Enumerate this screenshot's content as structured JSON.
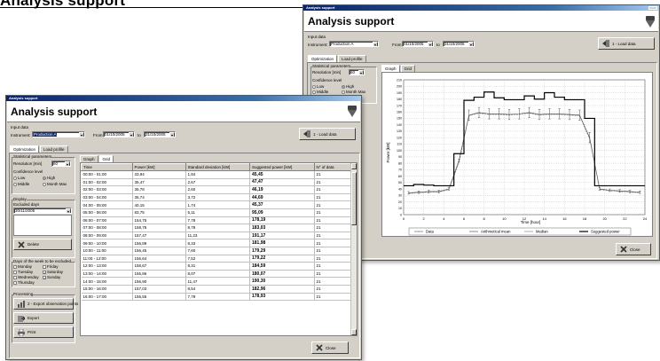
{
  "heading": "Analysis support",
  "app": {
    "window_caption": "Analysis support",
    "title": "Analysis support"
  },
  "input": {
    "section_label": "Input data",
    "instrument_label": "Instrument:",
    "instrument_value": "Production A",
    "from_label": "From",
    "from_value": "01/10/2005",
    "to_label": "to",
    "to_value": "31/10/2005",
    "load_button": "1 - Load data"
  },
  "tabs": [
    "Optimization",
    "Load profile"
  ],
  "sub_tabs": [
    "Graph",
    "Grid"
  ],
  "stats": {
    "group_label": "Statistical parameters",
    "resolution_label": "Resolution [min]",
    "resolution_value": "60",
    "confidence_label": "Confidence level",
    "options": [
      "Low",
      "High",
      "Middle",
      "Month Max"
    ],
    "selected": "High"
  },
  "display": {
    "label": "Display",
    "excluded_label": "Excluded days",
    "excluded_value": "30/11/2005",
    "delete_button": "Delete"
  },
  "days": {
    "label": "Days of the week to be excluded",
    "items": [
      {
        "name": "Monday",
        "checked": false
      },
      {
        "name": "Friday",
        "checked": false
      },
      {
        "name": "Tuesday",
        "checked": false
      },
      {
        "name": "Saturday",
        "checked": true
      },
      {
        "name": "Wednesday",
        "checked": false
      },
      {
        "name": "Sunday",
        "checked": true
      },
      {
        "name": "Thursday",
        "checked": false
      }
    ]
  },
  "processing": {
    "label": "Processing",
    "export_points": "2 - Export observation points",
    "export": "Export",
    "print": "Print"
  },
  "close_button": "Close",
  "grid": {
    "columns": [
      "Time",
      "Power [kW]",
      "Standard deviation [kW]",
      "Suggested power [kW]",
      "N° of data"
    ],
    "rows": [
      [
        "00:00 - 01:00",
        "33,94",
        "1,84",
        "45,45",
        "21"
      ],
      [
        "01:00 - 02:00",
        "35,47",
        "2,67",
        "47,47",
        "21"
      ],
      [
        "02:00 - 03:00",
        "35,78",
        "2,60",
        "46,19",
        "21"
      ],
      [
        "03:00 - 04:00",
        "35,74",
        "3,72",
        "44,69",
        "21"
      ],
      [
        "04:00 - 05:00",
        "40,15",
        "1,74",
        "45,37",
        "21"
      ],
      [
        "05:00 - 06:00",
        "83,75",
        "5,11",
        "95,09",
        "21"
      ],
      [
        "06:00 - 07:00",
        "154,75",
        "7,78",
        "178,19",
        "21"
      ],
      [
        "07:00 - 08:00",
        "158,75",
        "8,78",
        "183,03",
        "21"
      ],
      [
        "08:00 - 09:00",
        "157,47",
        "11,23",
        "191,17",
        "21"
      ],
      [
        "09:00 - 10:00",
        "156,89",
        "8,33",
        "181,98",
        "21"
      ],
      [
        "10:00 - 11:00",
        "156,45",
        "7,60",
        "179,29",
        "21"
      ],
      [
        "11:00 - 12:00",
        "156,64",
        "7,52",
        "179,22",
        "21"
      ],
      [
        "12:00 - 13:00",
        "158,67",
        "8,31",
        "184,59",
        "21"
      ],
      [
        "13:00 - 14:00",
        "155,86",
        "8,07",
        "180,07",
        "21"
      ],
      [
        "14:00 - 15:00",
        "156,90",
        "11,47",
        "190,30",
        "21"
      ],
      [
        "15:00 - 16:00",
        "157,03",
        "8,54",
        "182,96",
        "21"
      ],
      [
        "16:00 - 17:00",
        "155,55",
        "7,79",
        "178,93",
        "21"
      ]
    ]
  },
  "chart_data": {
    "type": "line",
    "ylabel": "Power [kW]",
    "xlabel": "Time [hour]",
    "xlim": [
      0,
      24
    ],
    "ylim": [
      0,
      210
    ],
    "x_ticks": [
      0,
      2,
      4,
      6,
      8,
      10,
      12,
      14,
      16,
      18,
      20,
      22,
      24
    ],
    "y_ticks": [
      0,
      10,
      20,
      30,
      40,
      50,
      60,
      70,
      80,
      90,
      100,
      110,
      120,
      130,
      140,
      150,
      160,
      170,
      180,
      190,
      200,
      210
    ],
    "grid": true,
    "legend_position": "bottom",
    "series": [
      {
        "name": "Data",
        "color": "#555555",
        "style": "error-bars",
        "x": [
          0.5,
          1.5,
          2.5,
          3.5,
          4.5,
          5.5,
          6.5,
          7.5,
          8.5,
          9.5,
          10.5,
          11.5,
          12.5,
          13.5,
          14.5,
          15.5,
          16.5,
          17.5,
          18.5,
          19.5,
          20.5,
          21.5,
          22.5,
          23.5
        ],
        "values": [
          34,
          35,
          36,
          36,
          40,
          84,
          155,
          159,
          157,
          157,
          156,
          157,
          159,
          156,
          157,
          157,
          156,
          155,
          120,
          40,
          38,
          37,
          36,
          35
        ]
      },
      {
        "name": "Arithmetical mean",
        "color": "#3a3a3a",
        "x": [
          0.5,
          1.5,
          2.5,
          3.5,
          4.5,
          5.5,
          6.5,
          7.5,
          8.5,
          9.5,
          10.5,
          11.5,
          12.5,
          13.5,
          14.5,
          15.5,
          16.5,
          17.5,
          18.5,
          19.5,
          20.5,
          21.5,
          22.5,
          23.5
        ],
        "values": [
          34,
          35,
          36,
          36,
          40,
          84,
          155,
          159,
          157,
          157,
          156,
          157,
          159,
          156,
          157,
          157,
          156,
          155,
          120,
          40,
          38,
          37,
          36,
          35
        ]
      },
      {
        "name": "Median",
        "color": "#777777",
        "x": [
          0.5,
          1.5,
          2.5,
          3.5,
          4.5,
          5.5,
          6.5,
          7.5,
          8.5,
          9.5,
          10.5,
          11.5,
          12.5,
          13.5,
          14.5,
          15.5,
          16.5,
          17.5,
          18.5,
          19.5,
          20.5,
          21.5,
          22.5,
          23.5
        ],
        "values": [
          33,
          34,
          35,
          35,
          39,
          80,
          154,
          158,
          156,
          156,
          155,
          156,
          158,
          155,
          156,
          156,
          155,
          154,
          118,
          39,
          37,
          36,
          35,
          34
        ]
      },
      {
        "name": "Suggested power",
        "color": "#000000",
        "style": "step",
        "x": [
          0,
          1,
          2,
          3,
          4,
          5,
          6,
          7,
          8,
          9,
          10,
          11,
          12,
          13,
          14,
          15,
          16,
          17,
          18,
          19,
          20,
          21,
          22,
          23
        ],
        "values": [
          45,
          47,
          46,
          45,
          45,
          95,
          178,
          183,
          191,
          182,
          179,
          179,
          185,
          180,
          190,
          183,
          179,
          179,
          150,
          45,
          45,
          45,
          45,
          45
        ]
      }
    ]
  },
  "back_window": {
    "graph_tab": "Graph",
    "grid_tab": "Grid"
  }
}
